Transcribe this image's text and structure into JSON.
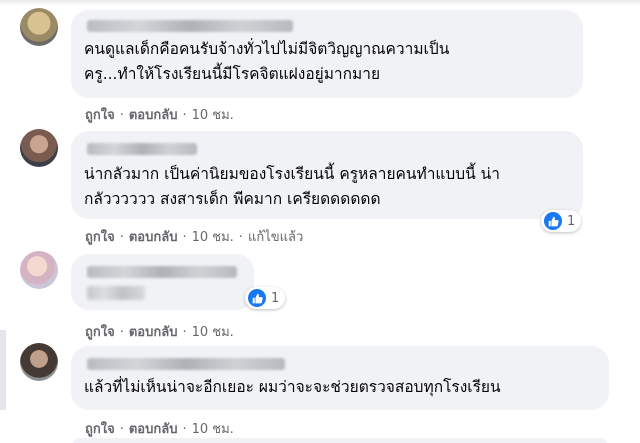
{
  "comments": [
    {
      "text_lines": [
        "คนดูแลเด็กคือคนรับจ้างทั่วไปไม่มีจิตวิญญาณความเป็น",
        "ครู...ทำให้โรงเรียนนี้มีโรคจิตแฝงอยู่มากมาย"
      ],
      "like_label": "ถูกใจ",
      "reply_label": "ตอบกลับ",
      "time": "10 ชม."
    },
    {
      "text_lines": [
        "น่ากลัวมาก เป็นค่านิยมของโรงเรียนนี้ ครูหลายคนทำแบบนี้ น่า",
        "กลัวววววว สงสารเด็ก พีคมาก เครียดดดดดด"
      ],
      "like_label": "ถูกใจ",
      "reply_label": "ตอบกลับ",
      "time": "10 ชม.",
      "edited_label": "แก้ไขแล้ว",
      "reaction_count": "1"
    },
    {
      "text_lines": [],
      "like_label": "ถูกใจ",
      "reply_label": "ตอบกลับ",
      "time": "10 ชม.",
      "reaction_count": "1"
    },
    {
      "text_lines": [
        "แล้วที่ไม่เห็นน่าจะอีกเยอะ ผมว่าจะจะช่วยตรวจสอบทุกโรงเรียน"
      ],
      "like_label": "ถูกใจ",
      "reply_label": "ตอบกลับ",
      "time": "10 ชม."
    }
  ],
  "separator": "·",
  "colors": {
    "bubble": "#f0f2f5",
    "meta_text": "#65676b",
    "like_blue": "#1877f2"
  },
  "icons": [
    "like-icon"
  ]
}
